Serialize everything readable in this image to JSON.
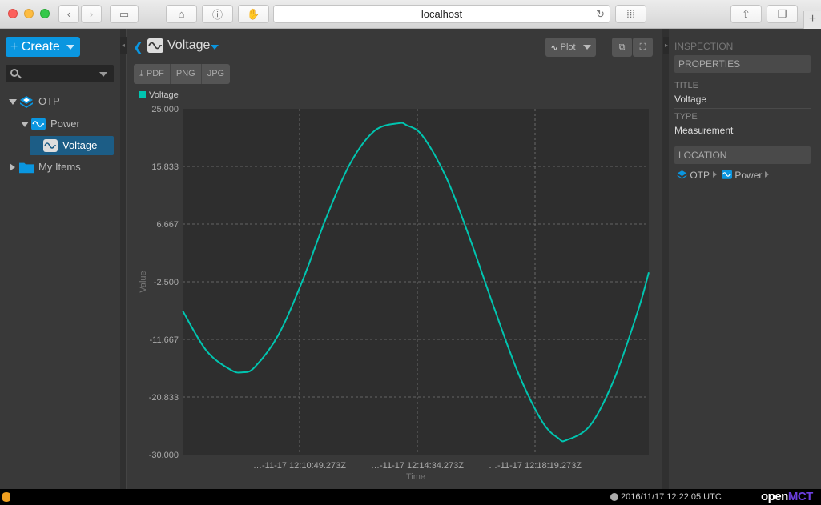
{
  "browser": {
    "url": "localhost",
    "reload_glyph": "↻"
  },
  "sidebar": {
    "create_label": "Create",
    "search_placeholder": "",
    "tree": [
      {
        "label": "OTP",
        "icon": "layers-icon",
        "expanded": true
      },
      {
        "label": "Power",
        "icon": "telemetry-icon",
        "expanded": true
      },
      {
        "label": "Voltage",
        "icon": "telemetry-icon",
        "selected": true
      },
      {
        "label": "My Items",
        "icon": "folder-icon",
        "expanded": false
      }
    ]
  },
  "main": {
    "title": "Voltage",
    "view_label": "Plot",
    "export": [
      "PDF",
      "PNG",
      "JPG"
    ]
  },
  "inspector": {
    "heading": "INSPECTION",
    "properties_label": "PROPERTIES",
    "title_label": "TITLE",
    "title_value": "Voltage",
    "type_label": "TYPE",
    "type_value": "Measurement",
    "location_label": "LOCATION",
    "location_path": [
      "OTP",
      "Power"
    ]
  },
  "status": {
    "time": "2016/11/17 12:22:05 UTC",
    "brand_a": "open",
    "brand_b": "MCT"
  },
  "colors": {
    "accent": "#0a96e0",
    "series": "#00c5b0",
    "plot_bg": "#2e2e2e"
  },
  "chart_data": {
    "type": "line",
    "title": "",
    "xlabel": "Time",
    "ylabel": "Value",
    "ylim": [
      -30.0,
      25.0
    ],
    "y_ticks": [
      "25.000",
      "15.833",
      "6.667",
      "-2.500",
      "-11.667",
      "-20.833",
      "-30.000"
    ],
    "x_ticks": [
      "…-11-17 12:10:49.273Z",
      "…-11-17 12:14:34.273Z",
      "…-11-17 12:18:19.273Z"
    ],
    "series": [
      {
        "name": "Voltage",
        "x": [
          0,
          30,
          60,
          75,
          90,
          120,
          150,
          180,
          210,
          240,
          270,
          280,
          300,
          330,
          360,
          390,
          420,
          450,
          470,
          480,
          510,
          540,
          570,
          583
        ],
        "values": [
          -7.1,
          -13.5,
          -16.5,
          -16.9,
          -16.1,
          -10.9,
          -2.3,
          7.8,
          16.4,
          21.5,
          22.7,
          22.4,
          20.7,
          14.0,
          4.1,
          -6.8,
          -17.1,
          -24.8,
          -27.4,
          -27.7,
          -25.3,
          -17.9,
          -6.9,
          -1.0
        ]
      }
    ]
  }
}
